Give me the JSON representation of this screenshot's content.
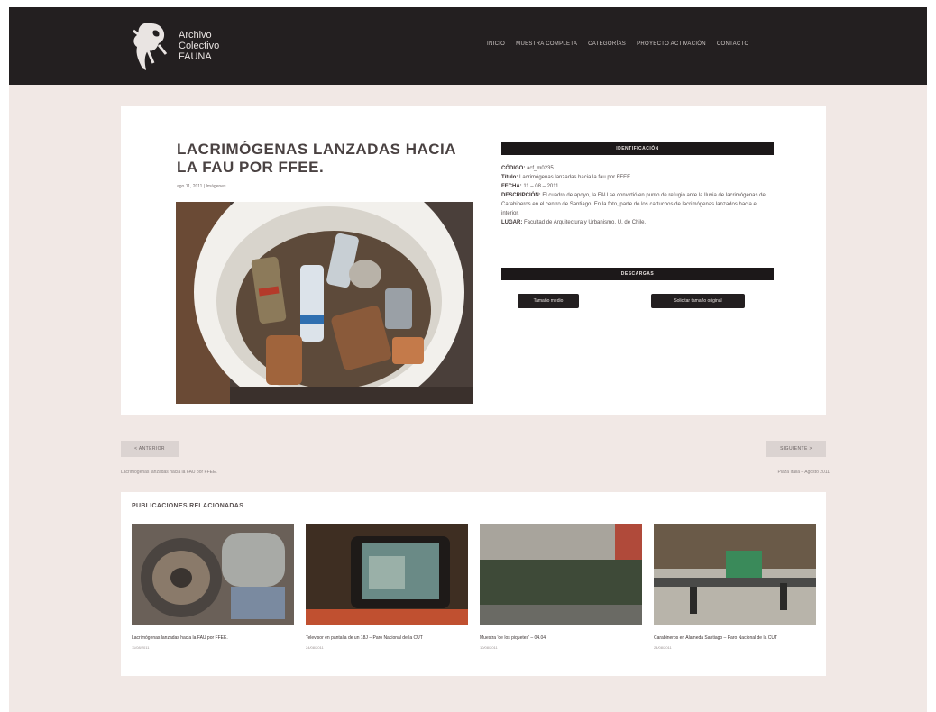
{
  "header": {
    "logo_line1": "Archivo",
    "logo_line2": "Colectivo",
    "logo_line3": "FAUNA",
    "nav": [
      "INICIO",
      "MUESTRA COMPLETA",
      "CATEGORÍAS",
      "PROYECTO ACTIVACIÓN",
      "CONTACTO"
    ]
  },
  "post": {
    "title": "LACRIMÓGENAS LANZADAS HACIA LA FAU POR FFEE.",
    "meta": "ago 11, 2011 | Imágenes"
  },
  "identification": {
    "header": "IDENTIFICACIÓN",
    "code_label": "CÓDIGO:",
    "code_value": "acf_m0235",
    "title_label": "Título:",
    "title_value": "Lacrimógenas lanzadas hacia la fau por FFEE.",
    "date_label": "FECHA:",
    "date_value": "11 – 08 – 2011",
    "desc_label": "DESCRIPCIÓN:",
    "desc_value": "El cuadro de apoyo, la FAU se convirtió en punto de refugio ante la lluvia de lacrimógenas de Carabineros en el centro de Santiago. En la foto, parte de los cartuchos de lacrimógenas lanzados hacia el interior.",
    "place_label": "LUGAR:",
    "place_value": "Facultad de Arquitectura y Urbanismo, U. de Chile."
  },
  "downloads": {
    "header": "DESCARGAS",
    "btn1": "Tamaño medio",
    "btn2": "Solicitar tamaño original"
  },
  "pagination": {
    "prev_label": "< ANTERIOR",
    "prev_title": "Lacrimógenas lanzadas hacia la FAU por FFEE.",
    "next_label": "SIGUIENTE >",
    "next_title": "Plaza Italia – Agosto 2011"
  },
  "related": {
    "title": "PUBLICACIONES RELACIONADAS",
    "items": [
      {
        "caption": "Lacrimógenas lanzadas hacia la FAU por FFEE.",
        "date": "11/08/2011"
      },
      {
        "caption": "Televisor en pantalla de un 18J – Paro Nacional de la CUT",
        "date": "24/08/2011"
      },
      {
        "caption": "Muestra 'de los piquetes' – 04.04",
        "date": "10/08/2011"
      },
      {
        "caption": "Carabineros en Alameda Santiago – Paro Nacional de la CUT",
        "date": "24/08/2011"
      }
    ]
  },
  "colors": {
    "header_bg": "#231f20",
    "page_bg": "#f1e8e5",
    "bar_bg": "#1c1819"
  }
}
